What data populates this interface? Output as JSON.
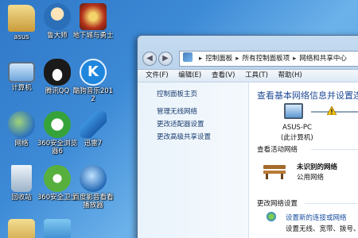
{
  "desktop": {
    "icons": [
      {
        "label": "asus",
        "icon": "user-folder-icon",
        "color": "#d8b86a"
      },
      {
        "label": "鲁大师",
        "icon": "ludashi-icon",
        "color": "#3b8fd6"
      },
      {
        "label": "地下城与勇士",
        "icon": "dnf-game-icon",
        "color": "#c94a2c"
      },
      {
        "label": "计算机",
        "icon": "computer-icon",
        "color": "#7fb2e0"
      },
      {
        "label": "腾讯QQ",
        "icon": "qq-penguin-icon",
        "color": "#222222"
      },
      {
        "label": "酷狗音乐2012",
        "icon": "kugou-icon",
        "color": "#2a8ee0"
      },
      {
        "label": "网络",
        "icon": "network-globe-icon",
        "color": "#3c7cc6"
      },
      {
        "label": "360安全浏览器6",
        "icon": "360-browser-icon",
        "color": "#3aa63a"
      },
      {
        "label": "迅雷7",
        "icon": "xunlei-bird-icon",
        "color": "#3d8fd8"
      },
      {
        "label": "回收站",
        "icon": "recycle-bin-icon",
        "color": "#9fb6cc"
      },
      {
        "label": "360安全卫士",
        "icon": "360-guard-icon",
        "color": "#58b040"
      },
      {
        "label": "百度影音看看播放器",
        "icon": "player-icon",
        "color": "#2e7ecf"
      }
    ]
  },
  "window": {
    "breadcrumb": [
      "控制面板",
      "所有控制面板项",
      "网络和共享中心"
    ],
    "back_glyph": "◀",
    "forward_glyph": "▶",
    "menu": [
      "文件(F)",
      "编辑(E)",
      "查看(V)",
      "工具(T)",
      "帮助(H)"
    ],
    "sidebar": {
      "home": "控制面板主页",
      "links": [
        "管理无线网络",
        "更改适配器设置",
        "更改高级共享设置"
      ]
    },
    "main": {
      "title": "查看基本网络信息并设置连接",
      "pc_name": "ASUS-PC",
      "pc_sub": "(此计算机)",
      "active_header": "查看活动网络",
      "network_name": "未识别的网络",
      "network_type": "公用网络",
      "change_header": "更改网络设置",
      "new_conn_link": "设置新的连接或网络",
      "new_conn_desc": "设置无线、宽带、拨号、临"
    }
  }
}
